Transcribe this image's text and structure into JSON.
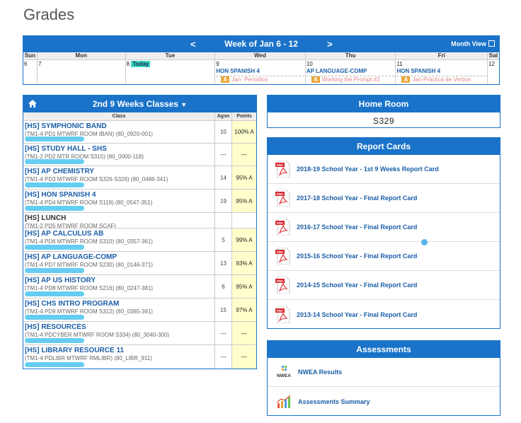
{
  "page": {
    "title": "Grades"
  },
  "calendar": {
    "prev_label": "<",
    "next_label": ">",
    "week_label": "Week of Jan 6 - 12",
    "month_view_label": "Month View",
    "days": [
      "Sun",
      "Mon",
      "Tue",
      "Wed",
      "Thu",
      "Fri",
      "Sat"
    ],
    "dates": [
      "6",
      "7",
      "8",
      "9",
      "10",
      "11",
      "12"
    ],
    "today_label": "Today",
    "events": {
      "wed": {
        "class": "HON SPANISH 4",
        "badge": "A",
        "assignment": "Jan- Periodico"
      },
      "thu": {
        "class": "AP LANGUAGE-COMP",
        "badge": "A",
        "assignment": "Working the Prompt #2"
      },
      "fri": {
        "class": "HON SPANISH 4",
        "badge": "A",
        "assignment": "Jan-Práctica de Verbos"
      }
    }
  },
  "classes": {
    "title": "2nd 9 Weeks Classes",
    "dropdown_caret": "▼",
    "columns": {
      "class": "Class",
      "assign": "Agsn",
      "points": "Points"
    },
    "rows": [
      {
        "name": "[HS] SYMPHONIC BAND",
        "detail": "(TM1-4 PD1 MTWRF ROOM IBAN) (80_0920-001)",
        "assign": "10",
        "points": "100% A"
      },
      {
        "name": "[HS] STUDY HALL - SHS",
        "detail": "(TM1-2 PD2 MTR ROOM S315) (80_0000-118)",
        "assign": "—",
        "points": "—"
      },
      {
        "name": "[HS] AP CHEMISTRY",
        "detail": "(TM1-4 PD3 MTWRF ROOM S326-S326) (80_0486-341)",
        "assign": "14",
        "points": "95% A"
      },
      {
        "name": "[HS] HON SPANISH 4",
        "detail": "(TM1-4 PD4 MTWRF ROOM S119) (80_0547-351)",
        "assign": "19",
        "points": "95% A"
      },
      {
        "name": "[HS] LUNCH",
        "detail": "(TM1-2 PD5 MTWRF ROOM SCAF)",
        "assign": "",
        "points": ""
      },
      {
        "name": "[HS] AP CALCULUS AB",
        "detail": "(TM1-4 PD6 MTWRF ROOM S310) (80_0357-361)",
        "assign": "5",
        "points": "99% A"
      },
      {
        "name": "[HS] AP LANGUAGE-COMP",
        "detail": "(TM1-4 PD7 MTWRF ROOM S230) (80_0146-371)",
        "assign": "13",
        "points": "93% A"
      },
      {
        "name": "[HS] AP US HISTORY",
        "detail": "(TM1-4 PD8 MTWRF ROOM S216) (80_0247-381)",
        "assign": "6",
        "points": "95% A"
      },
      {
        "name": "[HS] CHS INTRO PROGRAM",
        "detail": "(TM1-4 PD9 MTWRF ROOM S312) (80_0365-391)",
        "assign": "15",
        "points": "97% A"
      },
      {
        "name": "[HS] RESOURCES",
        "detail": "(TM1-4 PDCYBER MTWRF ROOM S334) (80_3040-300)",
        "assign": "—",
        "points": "—"
      },
      {
        "name": "[HS] LIBRARY RESOURCE 11",
        "detail": "(TM1-4 PDLIBR MTWRF RMLIBR) (80_LIBR_911)",
        "assign": "—",
        "points": "—"
      }
    ]
  },
  "homeroom": {
    "title": "Home Room",
    "value": "S329"
  },
  "report_cards": {
    "title": "Report Cards",
    "items": [
      "2018-19 School Year - 1st 9 Weeks Report Card",
      "2017-18 School Year - Final Report Card",
      "2016-17 School Year - Final Report Card",
      "2015-16 School Year - Final Report Card",
      "2014-15 School Year - Final Report Card",
      "2013-14 School Year - Final Report Card"
    ],
    "icon_text": "PDF"
  },
  "assessments": {
    "title": "Assessments",
    "nwea_label": "NWEA Results",
    "nwea_icon_text": "NWEA",
    "summary_label": "Assessments Summary"
  },
  "colors": {
    "accent": "#1a73c9",
    "link": "#1a5ea8",
    "today": "#3dd6c6",
    "points_bg": "#ffffcc",
    "badge": "#e8a73a"
  }
}
